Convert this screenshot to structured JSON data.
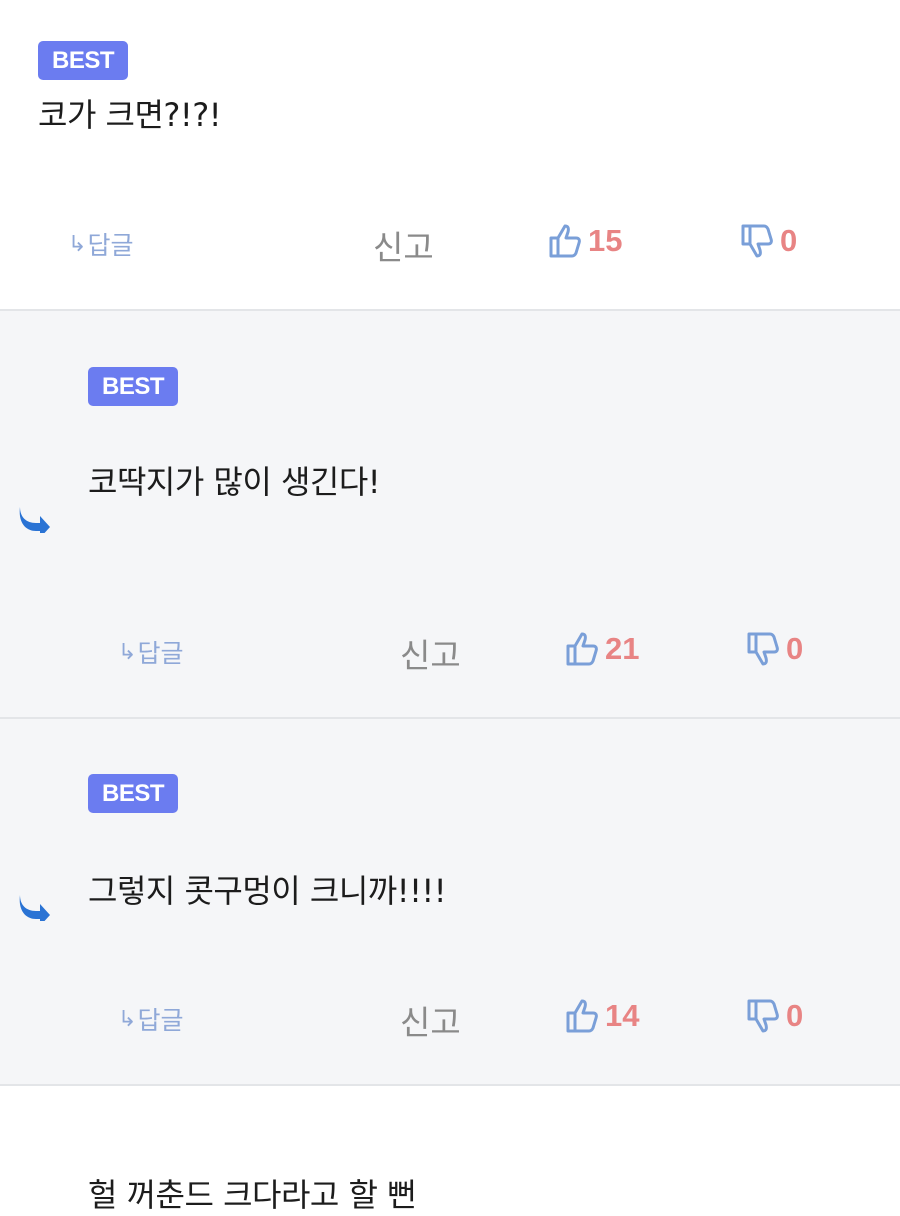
{
  "comments": [
    {
      "badge": "BEST",
      "text": "코가 크면?!?!",
      "reply_label": "답글",
      "report_label": "신고",
      "likes": "15",
      "dislikes": "0"
    },
    {
      "badge": "BEST",
      "text": "코딱지가 많이 생긴다!",
      "reply_label": "답글",
      "report_label": "신고",
      "likes": "21",
      "dislikes": "0"
    },
    {
      "badge": "BEST",
      "text": "그렇지 콧구멍이 크니까!!!!",
      "reply_label": "답글",
      "report_label": "신고",
      "likes": "14",
      "dislikes": "0"
    },
    {
      "text": "헐 꺼춘드 크다라고 할 뻔"
    }
  ],
  "colors": {
    "badge": "#6b7cf0",
    "count": "#e88484",
    "thumb": "#7a9fd8",
    "reply_arrow": "#2a73d4"
  },
  "icons": [
    "reply-arrow-icon",
    "thumbs-up-icon",
    "thumbs-down-icon"
  ]
}
